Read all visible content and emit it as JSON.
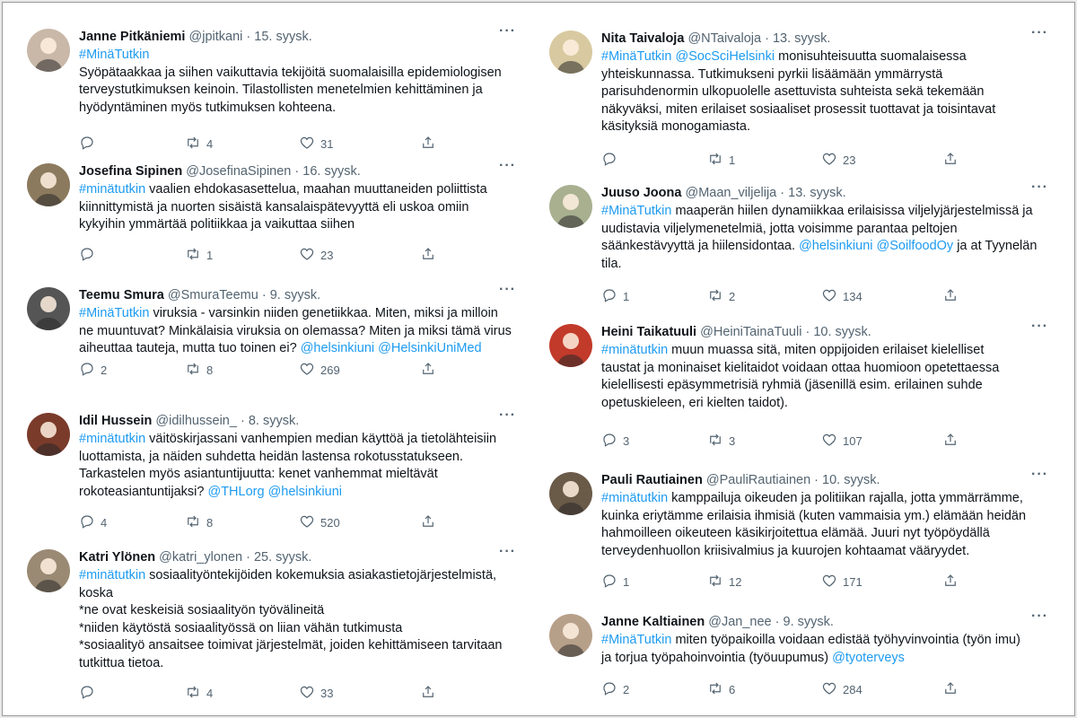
{
  "left": [
    {
      "name": "Janne Pitkäniemi",
      "handle": "@jpitkani",
      "date": "15. syysk.",
      "avatar_color": "#c9b8a8",
      "lines": [
        [
          {
            "t": "#MinäTutkin",
            "h": true
          }
        ],
        [
          {
            "t": "Syöpätaakkaa ja siihen vaikuttavia tekijöitä suomalaisilla epidemiologisen"
          }
        ],
        [
          {
            "t": "terveystutkimuksen keinoin. Tilastollisten menetelmien kehittäminen ja"
          }
        ],
        [
          {
            "t": "hyödyntäminen myös tutkimuksen kohteena."
          }
        ]
      ],
      "reply": "",
      "retweet": "4",
      "like": "31"
    },
    {
      "name": "Josefina Sipinen",
      "handle": "@JosefinaSipinen",
      "date": "16. syysk.",
      "avatar_color": "#8c7a5e",
      "lines": [
        [
          {
            "t": "#minätutkin",
            "h": true
          },
          {
            "t": " vaalien ehdokasasettelua, maahan muuttaneiden poliittista"
          }
        ],
        [
          {
            "t": "kiinnittymistä ja nuorten sisäistä kansalaispätevyyttä eli uskoa omiin"
          }
        ],
        [
          {
            "t": "kykyihin ymmärtää politiikkaa ja vaikuttaa siihen"
          }
        ]
      ],
      "reply": "",
      "retweet": "1",
      "like": "23"
    },
    {
      "name": "Teemu Smura",
      "handle": "@SmuraTeemu",
      "date": "9. syysk.",
      "avatar_color": "#555555",
      "lines": [
        [
          {
            "t": "#MinäTutkin",
            "h": true
          },
          {
            "t": " viruksia - varsinkin niiden genetiikkaa. Miten, miksi ja milloin"
          }
        ],
        [
          {
            "t": "ne muuntuvat? Minkälaisia viruksia on olemassa? Miten ja miksi tämä virus"
          }
        ],
        [
          {
            "t": "aiheuttaa tauteja, mutta tuo toinen ei? "
          },
          {
            "t": "@helsinkiuni @HelsinkiUniMed",
            "h": true
          }
        ]
      ],
      "reply": "2",
      "retweet": "8",
      "like": "269"
    },
    {
      "name": "Idil Hussein",
      "handle": "@idilhussein_",
      "date": "8. syysk.",
      "avatar_color": "#7a3b2a",
      "lines": [
        [
          {
            "t": "#minätutkin",
            "h": true
          },
          {
            "t": " väitöskirjassani vanhempien median käyttöä ja tietolähteisiin"
          }
        ],
        [
          {
            "t": "luottamista, ja näiden suhdetta heidän lastensa rokotusstatukseen."
          }
        ],
        [
          {
            "t": "Tarkastelen myös asiantuntijuutta: kenet vanhemmat mieltävät"
          }
        ],
        [
          {
            "t": "rokoteasiantuntijaksi? "
          },
          {
            "t": "@THLorg @helsinkiuni",
            "h": true
          }
        ]
      ],
      "reply": "4",
      "retweet": "8",
      "like": "520"
    },
    {
      "name": "Katri Ylönen",
      "handle": "@katri_ylonen",
      "date": "25. syysk.",
      "avatar_color": "#9a8a74",
      "lines": [
        [
          {
            "t": "#minätutkin",
            "h": true
          },
          {
            "t": " sosiaalityöntekijöiden kokemuksia asiakastietojärjestelmistä,"
          }
        ],
        [
          {
            "t": "koska"
          }
        ],
        [
          {
            "t": "*ne ovat keskeisiä sosiaalityön työvälineitä"
          }
        ],
        [
          {
            "t": "*niiden käytöstä sosiaalityössä on  liian vähän tutkimusta"
          }
        ],
        [
          {
            "t": "*sosiaalityö ansaitsee toimivat järjestelmät, joiden kehittämiseen tarvitaan"
          }
        ],
        [
          {
            "t": "tutkittua tietoa."
          }
        ]
      ],
      "reply": "",
      "retweet": "4",
      "like": "33"
    }
  ],
  "right": [
    {
      "name": "Nita Taivaloja",
      "handle": "@NTaivaloja",
      "date": "13. syysk.",
      "avatar_color": "#d8c9a0",
      "lines": [
        [
          {
            "t": "#MinäTutkin",
            "h": true
          },
          {
            "t": " "
          },
          {
            "t": "@SocSciHelsinki",
            "h": true
          },
          {
            "t": " monisuhteisuutta suomalaisessa"
          }
        ],
        [
          {
            "t": "yhteiskunnassa. Tutkimukseni pyrkii lisäämään ymmärrystä"
          }
        ],
        [
          {
            "t": "parisuhdenormin ulkopuolelle asettuvista suhteista sekä tekemään"
          }
        ],
        [
          {
            "t": "näkyväksi, miten erilaiset sosiaaliset prosessit tuottavat ja toisintavat"
          }
        ],
        [
          {
            "t": "käsityksiä monogamiasta."
          }
        ]
      ],
      "reply": "",
      "retweet": "1",
      "like": "23"
    },
    {
      "name": "Juuso Joona",
      "handle": "@Maan_viljelija",
      "date": "13. syysk.",
      "avatar_color": "#a8b090",
      "lines": [
        [
          {
            "t": "#MinäTutkin",
            "h": true
          },
          {
            "t": " maaperän hiilen dynamiikkaa erilaisissa viljelyjärjestelmissä ja"
          }
        ],
        [
          {
            "t": "uudistavia viljelymenetelmiä, jotta voisimme parantaa peltojen"
          }
        ],
        [
          {
            "t": "säänkestävyyttä ja hiilensidontaa. "
          },
          {
            "t": "@helsinkiuni @SoilfoodOy",
            "h": true
          },
          {
            "t": " ja at Tyynelän"
          }
        ],
        [
          {
            "t": "tila."
          }
        ]
      ],
      "reply": "1",
      "retweet": "2",
      "like": "134"
    },
    {
      "name": "Heini Taikatuuli",
      "handle": "@HeiniTainaTuuli",
      "date": "10. syysk.",
      "avatar_color": "#c23a2a",
      "lines": [
        [
          {
            "t": "#minätutkin",
            "h": true
          },
          {
            "t": " muun muassa sitä, miten oppijoiden erilaiset kielelliset"
          }
        ],
        [
          {
            "t": "taustat ja moninaiset kielitaidot voidaan ottaa huomioon opetettaessa"
          }
        ],
        [
          {
            "t": "kielellisesti epäsymmetrisiä ryhmiä (jäsenillä esim. erilainen suhde"
          }
        ],
        [
          {
            "t": "opetuskieleen, eri kielten taidot)."
          }
        ]
      ],
      "reply": "3",
      "retweet": "3",
      "like": "107"
    },
    {
      "name": "Pauli Rautiainen",
      "handle": "@PauliRautiainen",
      "date": "10. syysk.",
      "avatar_color": "#6a5a48",
      "lines": [
        [
          {
            "t": "#minätutkin",
            "h": true
          },
          {
            "t": " kamppailuja oikeuden ja politiikan rajalla, jotta ymmärrämme,"
          }
        ],
        [
          {
            "t": "kuinka eriytämme erilaisia ihmisiä (kuten vammaisia ym.) elämään heidän"
          }
        ],
        [
          {
            "t": "hahmoilleen oikeuteen käsikirjoitettua elämää. Juuri nyt työpöydällä"
          }
        ],
        [
          {
            "t": "terveydenhuollon kriisivalmius ja kuurojen kohtaamat vääryydet."
          }
        ]
      ],
      "reply": "1",
      "retweet": "12",
      "like": "171"
    },
    {
      "name": "Janne Kaltiainen",
      "handle": "@Jan_nee",
      "date": "9. syysk.",
      "avatar_color": "#b7a08a",
      "lines": [
        [
          {
            "t": "#MinäTutkin",
            "h": true
          },
          {
            "t": " miten työpaikoilla voidaan edistää työhyvinvointia (työn imu)"
          }
        ],
        [
          {
            "t": "ja torjua työpahoinvointia (työuupumus) "
          },
          {
            "t": "@tyoterveys",
            "h": true
          }
        ]
      ],
      "reply": "2",
      "retweet": "6",
      "like": "284"
    }
  ],
  "ui": {
    "separator": "·",
    "more": "···"
  }
}
